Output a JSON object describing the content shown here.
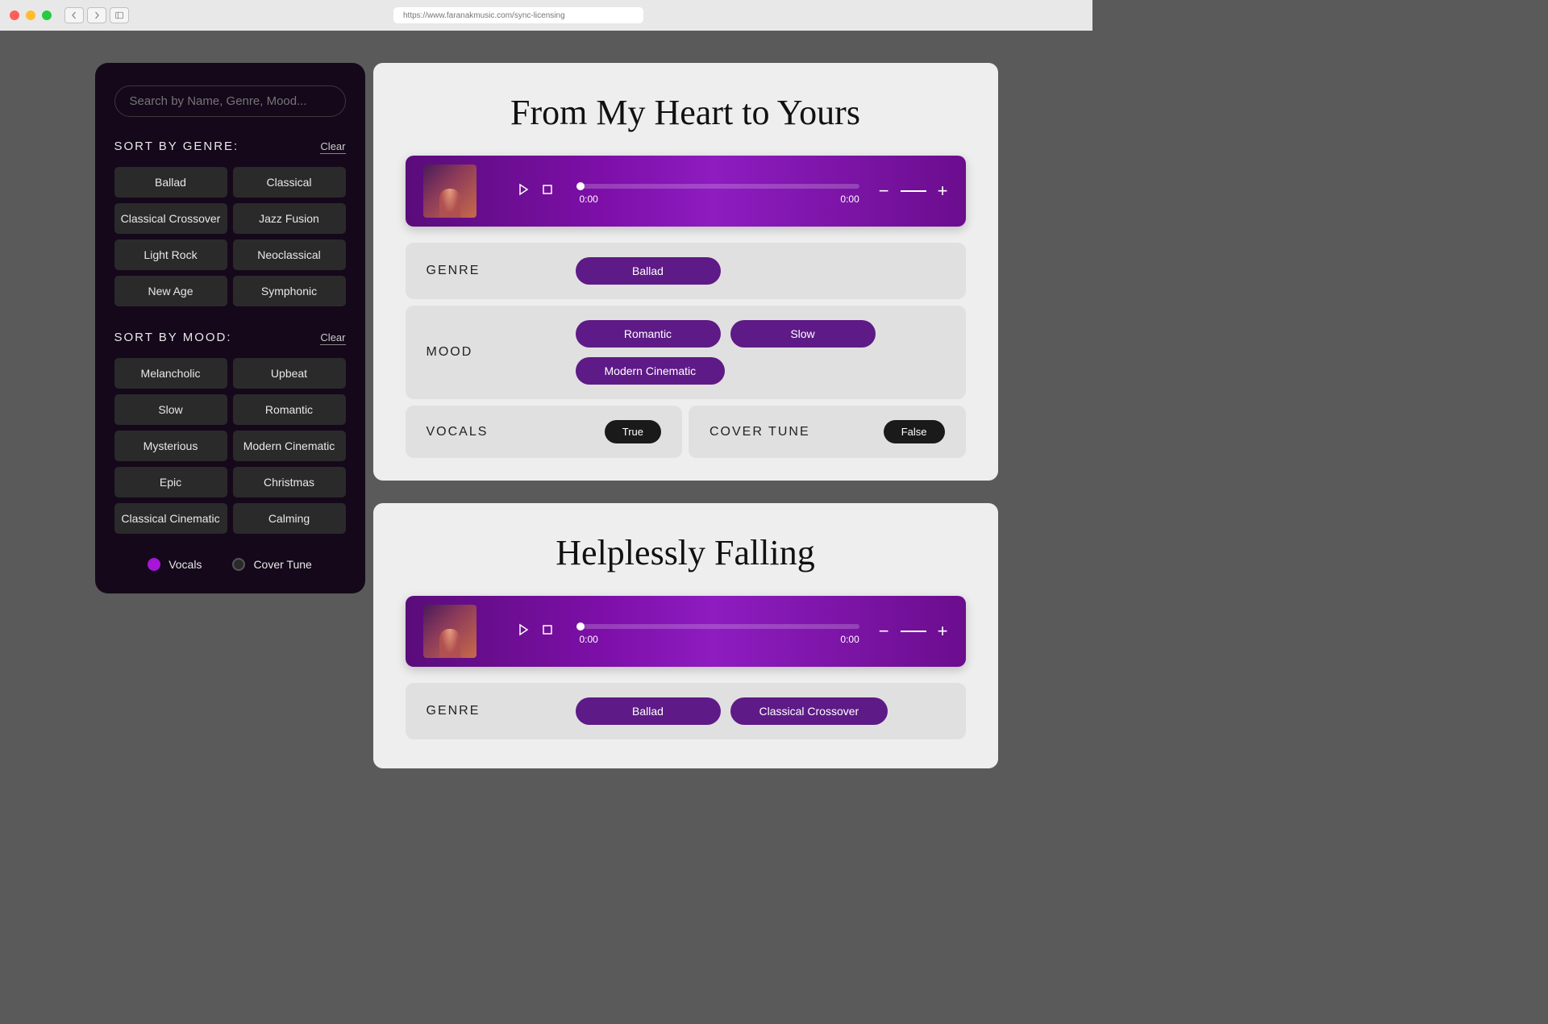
{
  "browser": {
    "url": "https://www.faranakmusic.com/sync-licensing"
  },
  "sidebar": {
    "search_placeholder": "Search by Name, Genre, Mood...",
    "genre": {
      "title": "SORT BY GENRE:",
      "clear": "Clear",
      "items": [
        "Ballad",
        "Classical",
        "Classical Crossover",
        "Jazz Fusion",
        "Light Rock",
        "Neoclassical",
        "New Age",
        "Symphonic"
      ]
    },
    "mood": {
      "title": "SORT BY MOOD:",
      "clear": "Clear",
      "items": [
        "Melancholic",
        "Upbeat",
        "Slow",
        "Romantic",
        "Mysterious",
        "Modern Cinematic",
        "Epic",
        "Christmas",
        "Classical Cinematic",
        "Calming"
      ]
    },
    "toggles": {
      "vocals": "Vocals",
      "cover": "Cover Tune"
    }
  },
  "tracks": [
    {
      "title": "From My Heart to Yours",
      "time_current": "0:00",
      "time_total": "0:00",
      "genre_label": "GENRE",
      "genres": [
        "Ballad"
      ],
      "mood_label": "MOOD",
      "moods": [
        "Romantic",
        "Slow",
        "Modern Cinematic"
      ],
      "vocals_label": "VOCALS",
      "vocals_value": "True",
      "cover_label": "COVER TUNE",
      "cover_value": "False"
    },
    {
      "title": "Helplessly Falling",
      "time_current": "0:00",
      "time_total": "0:00",
      "genre_label": "GENRE",
      "genres": [
        "Ballad",
        "Classical Crossover"
      ]
    }
  ]
}
